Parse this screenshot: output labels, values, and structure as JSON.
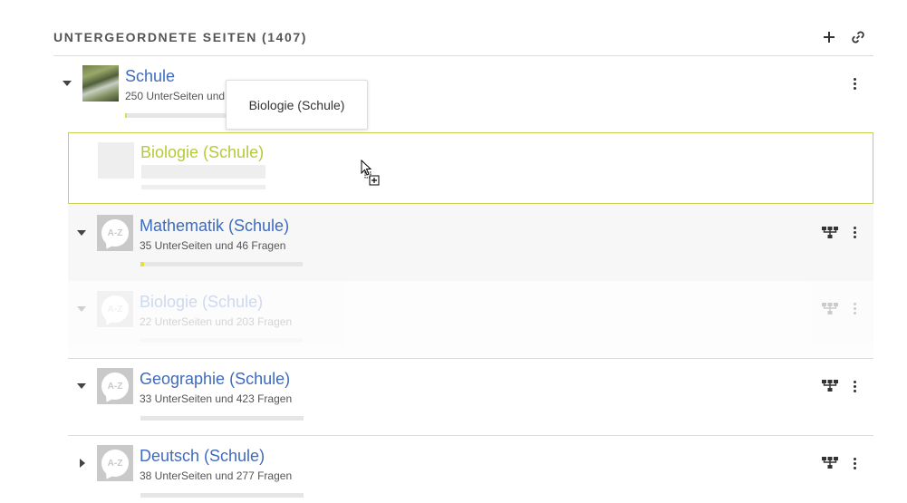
{
  "header": {
    "title": "UNTERGEORDNETE SEITEN",
    "count": "(1407)",
    "add_icon": "plus-icon",
    "link_icon": "link-icon"
  },
  "root": {
    "title": "Schule",
    "subtitle": "250 UnterSeiten und",
    "progress": 0.02
  },
  "tooltip": {
    "text": "Biologie (Schule)"
  },
  "drag_placeholder": {
    "title": "Biologie (Schule)"
  },
  "children": [
    {
      "title": "Mathematik (Schule)",
      "subtitle": "35 UnterSeiten und 46 Fragen",
      "thumb": "A-Z",
      "expanded": true,
      "progress": 0.02
    },
    {
      "title": "Biologie (Schule)",
      "subtitle": "22 UnterSeiten und 203 Fragen",
      "thumb": "A-Z",
      "expanded": true,
      "progress": 0
    },
    {
      "title": "Geographie (Schule)",
      "subtitle": "33 UnterSeiten und 423 Fragen",
      "thumb": "A-Z",
      "expanded": true,
      "progress": 0
    },
    {
      "title": "Deutsch (Schule)",
      "subtitle": "38 UnterSeiten und 277 Fragen",
      "thumb": "A-Z",
      "expanded": false,
      "progress": 0
    }
  ],
  "colors": {
    "link": "#3e6bbf",
    "drop_border": "#c7d24a",
    "drop_title": "#b8c93a",
    "progress_fill": "#e9df2e"
  }
}
